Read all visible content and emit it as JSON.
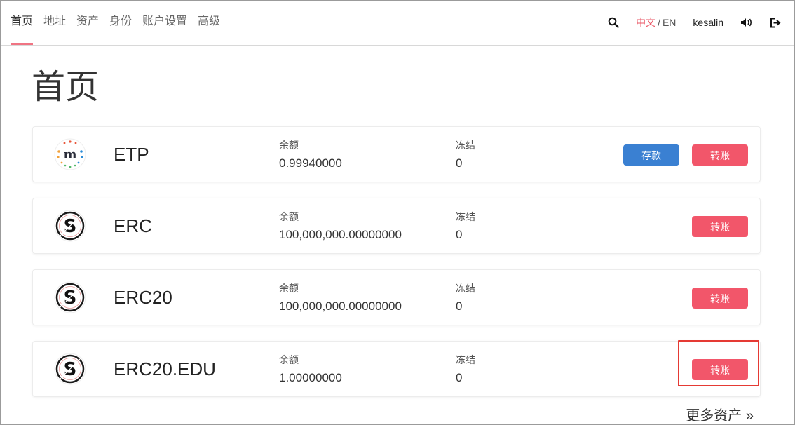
{
  "nav": {
    "items": [
      {
        "label": "首页",
        "active": true
      },
      {
        "label": "地址",
        "active": false
      },
      {
        "label": "资产",
        "active": false
      },
      {
        "label": "身份",
        "active": false
      },
      {
        "label": "账户设置",
        "active": false
      },
      {
        "label": "高级",
        "active": false
      }
    ],
    "lang_zh": "中文",
    "lang_sep": "/",
    "lang_en": "EN",
    "username": "kesalin",
    "icons": [
      "search-icon",
      "volume-icon",
      "logout-icon"
    ]
  },
  "page_title": "首页",
  "assets": [
    {
      "name": "ETP",
      "balance_label": "余额",
      "balance": "0.99940000",
      "frozen_label": "冻结",
      "frozen": "0",
      "deposit_label": "存款",
      "transfer_label": "转账",
      "logo": "metaverse-m-icon"
    },
    {
      "name": "ERC",
      "balance_label": "余额",
      "balance": "100,000,000.00000000",
      "frozen_label": "冻结",
      "frozen": "0",
      "transfer_label": "转账",
      "logo": "s-coin-icon"
    },
    {
      "name": "ERC20",
      "balance_label": "余额",
      "balance": "100,000,000.00000000",
      "frozen_label": "冻结",
      "frozen": "0",
      "transfer_label": "转账",
      "logo": "s-coin-icon"
    },
    {
      "name": "ERC20.EDU",
      "balance_label": "余额",
      "balance": "1.00000000",
      "frozen_label": "冻结",
      "frozen": "0",
      "transfer_label": "转账",
      "logo": "s-coin-icon"
    }
  ],
  "more_assets": "更多资产 »",
  "colors": {
    "accent": "#f07483",
    "transfer": "#f2566a",
    "deposit": "#3a80d2",
    "highlight": "#e53a34"
  }
}
